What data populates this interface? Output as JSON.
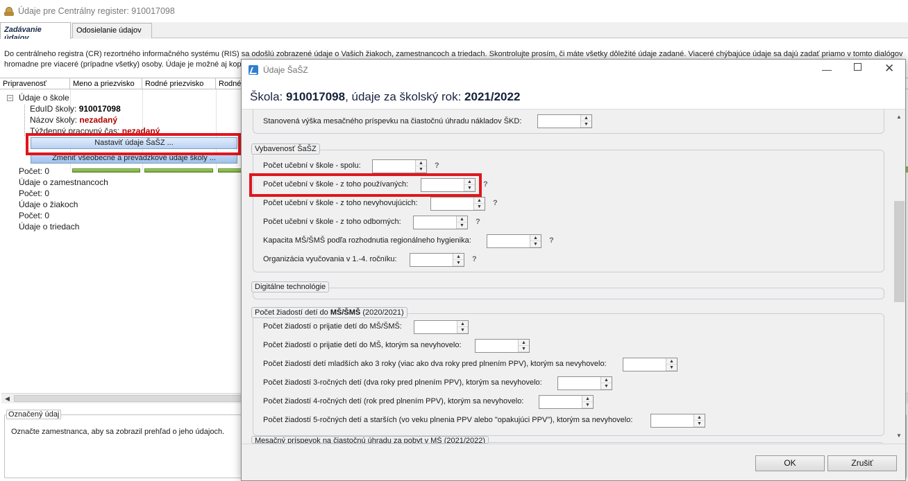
{
  "window": {
    "title": "Údaje pre Centrálny register: 910017098",
    "icon": "app-icon"
  },
  "tabs": [
    {
      "label": "Zadávanie údajov",
      "active": true
    },
    {
      "label": "Odosielanie údajov",
      "active": false
    }
  ],
  "description": {
    "line1": "Do centrálneho registra (CR) rezortného informačného systému (RIS) sa odošlú zobrazené údaje o Vašich žiakoch, zamestnancoch a triedach. Skontrolujte prosím, či máte všetky dôležité údaje zadané. Viaceré chýbajúce údaje sa dajú zadať priamo v tomto dialógov",
    "line2": "hromadne pre viaceré (prípadne všetky) osoby. Údaje je možné aj kop"
  },
  "grid": {
    "columns": [
      "Pripravenosť",
      "Meno a priezvisko",
      "Rodné priezvisko",
      "Rodné"
    ]
  },
  "tree": {
    "school_node": "Údaje o škole",
    "eduid_label": "EduID školy:",
    "eduid_value": "910017098",
    "name_label": "Názov školy:",
    "name_value": "nezadaný",
    "hours_label": "Týždenný pracovný čas:",
    "hours_value": "nezadaný",
    "btn_nastavit": "Nastaviť údaje ŠaŠZ ...",
    "btn_zmenit": "Zmeniť všeobecné a prevádzkové údaje školy ...",
    "count1": "Počet: 0",
    "employees": "Údaje o zamestnancoch",
    "count2": "Počet: 0",
    "students": "Údaje o žiakoch",
    "count3": "Počet: 0",
    "classes": "Údaje o triedach"
  },
  "selected": {
    "legend": "Označený údaj",
    "text": "Označte zamestnanca, aby sa zobrazil prehľad o jeho údajoch."
  },
  "dialog": {
    "title": "Údaje ŠaŠZ",
    "header_prefix": "Škola: ",
    "school_id": "910017098",
    "header_mid": ", údaje za školský rok: ",
    "year": "2021/2022",
    "top_row": "Stanovená výška mesačného príspevku na čiastočnú úhradu nákladov ŠKD:",
    "group1": {
      "title": "Vybavenosť ŠaŠZ",
      "rows": [
        "Počet učební v škole - spolu:",
        "Počet učební v škole - z toho používaných:",
        "Počet učební v škole - z toho nevyhovujúcich:",
        "Počet učební v škole - z toho odborných:",
        "Kapacita MŠ/ŠMŠ podľa rozhodnutia regionálneho hygienika:",
        "Organizácia vyučovania v 1.-4. ročníku:"
      ],
      "help": "?"
    },
    "group2": {
      "title": "Digitálne technológie"
    },
    "group3": {
      "title_prefix": "Počet žiadostí detí do ",
      "title_bold": "MŠ/ŠMŠ",
      "title_suffix": " (2020/2021)",
      "rows": [
        "Počet žiadostí o prijatie detí do MŠ/ŠMŠ:",
        "Počet žiadostí o prijatie detí do MŠ, ktorým sa nevyhovelo:",
        "Počet žiadostí detí mladších ako 3 roky (viac ako dva roky pred plnením PPV), ktorým sa nevyhovelo:",
        "Počet žiadostí 3-ročných detí (dva roky pred plnením PPV), ktorým sa nevyhovelo:",
        "Počet žiadostí 4-ročných detí (rok pred plnením PPV), ktorým sa nevyhovelo:",
        "Počet žiadostí 5-ročných detí a starších (vo veku plnenia PPV alebo \"opakujúci PPV\"), ktorým sa nevyhovelo:"
      ]
    },
    "cut_group_title": "Mesačný príspevok na čiastočnú úhradu za pobyt v MŠ (2021/2022)",
    "ok": "OK",
    "cancel": "Zrušiť"
  },
  "colors": {
    "highlight": "#e0161c",
    "progress": "#7fb13f"
  }
}
